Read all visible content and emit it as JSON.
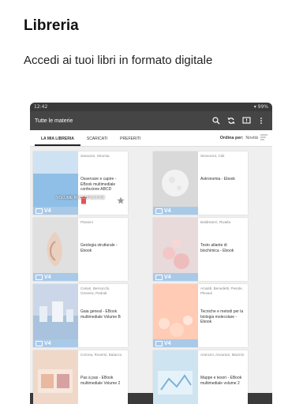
{
  "promo": {
    "title": "Libreria",
    "subtitle": "Accedi ai tuoi libri in formato digitale"
  },
  "status": {
    "time": "12:42",
    "battery": "99%"
  },
  "toolbar": {
    "title": "Tutte le materie"
  },
  "tabs": [
    {
      "label": "LA MIA LIBRERIA"
    },
    {
      "label": "SCARICATI"
    },
    {
      "label": "PREFERITI"
    }
  ],
  "sort": {
    "label": "Ordina per:",
    "value": "Novità"
  },
  "books": [
    {
      "authors": "Saraceni, Strumia",
      "title": "Osservare e capire - EBook multimediale confezione ABCD",
      "badge": "V4",
      "download_label": "VOLUME IN CONFEZIONE"
    },
    {
      "authors": "Simoncini, Citti",
      "title": "Astronomia - Ebook",
      "badge": "V4"
    },
    {
      "authors": "Pissioni",
      "title": "Geologia strutturale - Ebook",
      "badge": "V4"
    },
    {
      "authors": "Baldisserri, Rivalta",
      "title": "Testo atlante di biochimica - Ebook",
      "badge": "V4"
    },
    {
      "authors": "Cesari, Bernocchi, Grevera, Pedrali",
      "title": "Gaia geneal - EBook multimediale Volume B",
      "badge": "V4"
    },
    {
      "authors": "Amaldi, Benedetti, Pesole, Plevani",
      "title": "Tecniche e metodi per la biologia molecolare - Ebook",
      "badge": "V4"
    },
    {
      "authors": "Corona, Roversi, Batacco",
      "title": "Pas à pas - EBook multimediale Volume 2",
      "badge": "V4"
    },
    {
      "authors": "Arancini, Ancarani, Mazzini",
      "title": "Mappe e tesori - EBook multimediale volume 2",
      "badge": "V4"
    }
  ],
  "colors": {
    "accent": "#454545",
    "badge": "#a9c9e8",
    "trash": "#e05555"
  }
}
